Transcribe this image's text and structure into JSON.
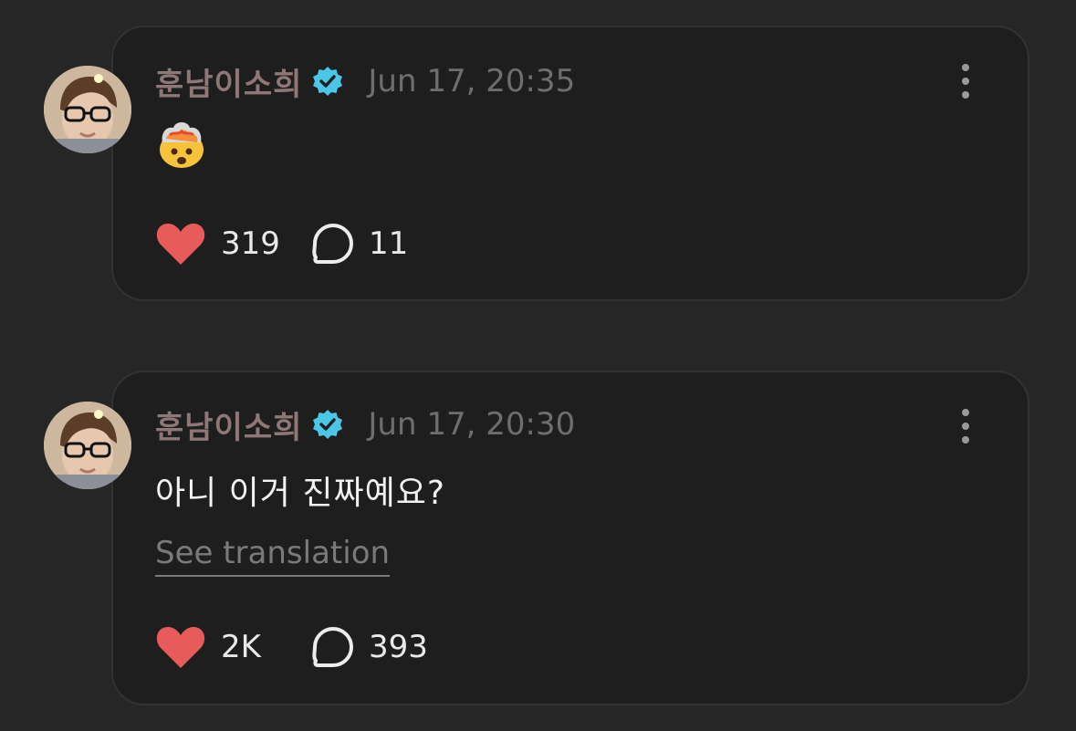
{
  "posts": [
    {
      "username": "훈남이소희",
      "timestamp": "Jun 17, 20:35",
      "content_emoji": "exploding-head-emoji",
      "likes": "319",
      "replies": "11"
    },
    {
      "username": "훈남이소희",
      "timestamp": "Jun 17, 20:30",
      "content_text": "아니 이거 진짜예요?",
      "translate_label": "See translation",
      "likes": "2K",
      "replies": "393"
    }
  ],
  "colors": {
    "background": "#262626",
    "card": "#1e1e1e",
    "username": "#8e7776",
    "timestamp": "#6e6e6e",
    "heart": "#e85b5b",
    "verified": "#4cc6e6"
  }
}
